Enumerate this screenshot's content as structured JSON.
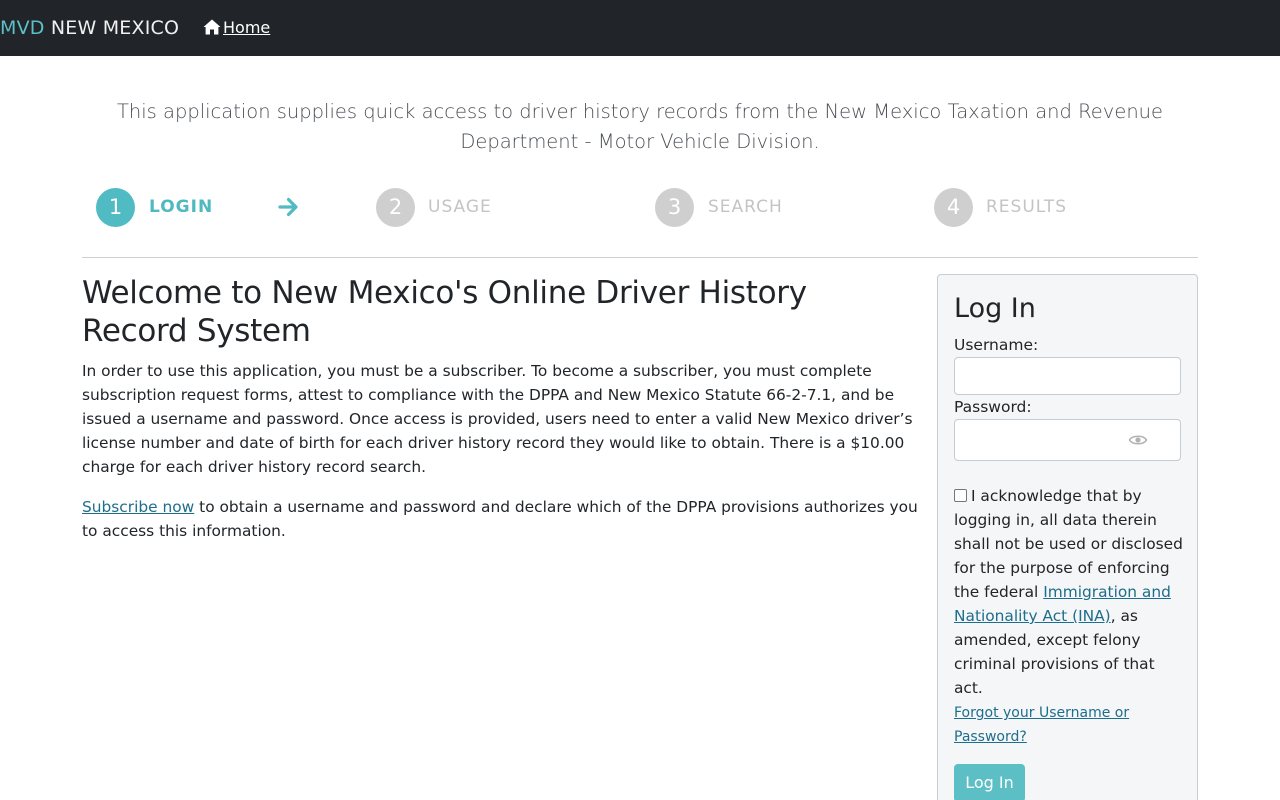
{
  "navbar": {
    "brand_accent": "MVD",
    "brand_text": "NEW MEXICO",
    "home_label": "Home",
    "home_icon": "home-icon"
  },
  "intro": "This application supplies quick access to driver history records from the New Mexico Taxation and Revenue Department - Motor Vehicle Division.",
  "steps": [
    {
      "number": "1",
      "label": "LOGIN",
      "state": "active"
    },
    {
      "number": "2",
      "label": "USAGE",
      "state": "inactive"
    },
    {
      "number": "3",
      "label": "SEARCH",
      "state": "inactive"
    },
    {
      "number": "4",
      "label": "RESULTS",
      "state": "inactive"
    }
  ],
  "step_arrow_icon": "arrow-right-icon",
  "main": {
    "title": "Welcome to New Mexico's Online Driver History Record System",
    "description": "In order to use this application, you must be a subscriber. To become a subscriber, you must complete subscription request forms, attest to compliance with the DPPA and New Mexico Statute 66-2-7.1, and be issued a username and password. Once access is provided, users need to enter a valid New Mexico driver’s license number and date of birth for each driver history record they would like to obtain. There is a $10.00 charge for each driver history record search.",
    "subscribe_link": "Subscribe now",
    "subscribe_text": " to obtain a username and password and declare which of the DPPA provisions authorizes you to access this information."
  },
  "login": {
    "title": "Log In",
    "username_label": "Username:",
    "username_value": "",
    "password_label": "Password:",
    "password_value": "",
    "show_password_icon": "eye-icon",
    "acknowledge_checked": false,
    "acknowledge_text_before": "I acknowledge that by logging in, all data therein shall not be used or disclosed for the purpose of enforcing the federal ",
    "acknowledge_link": "Immigration and Nationality Act (INA)",
    "acknowledge_text_after": ", as amended, except felony criminal provisions of that act.",
    "forgot_link": "Forgot your Username or Password?",
    "button_label": "Log In"
  },
  "colors": {
    "navbar_bg": "#212529",
    "accent": "#50bbc2",
    "link": "#1d6e8c",
    "inactive_step": "#cfcfcf"
  }
}
